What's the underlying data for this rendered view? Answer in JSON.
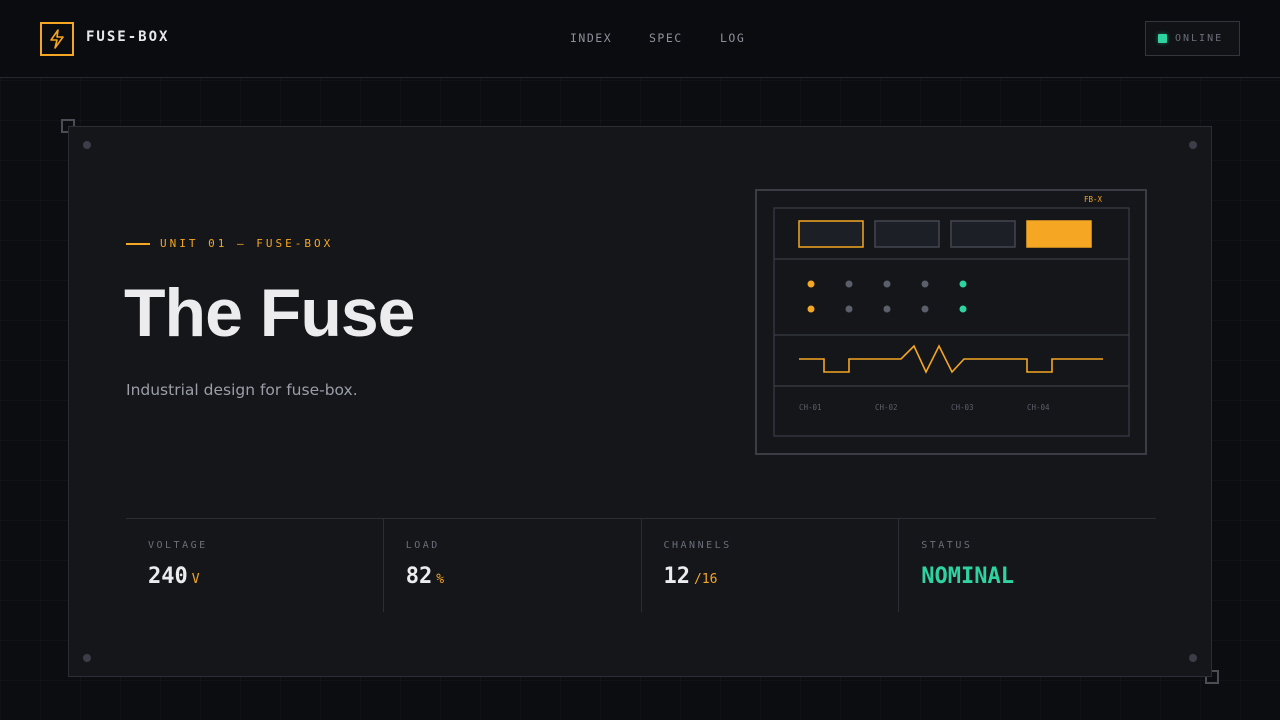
{
  "brand": {
    "name": "FUSE-BOX",
    "icon": "lightning-icon",
    "accent": "#f5a623"
  },
  "nav": {
    "items": [
      {
        "label": "INDEX"
      },
      {
        "label": "SPEC"
      },
      {
        "label": "LOG"
      }
    ]
  },
  "status": {
    "label": "ONLINE",
    "color": "#2ed3a0"
  },
  "hero": {
    "eyebrow": "UNIT 01 — FUSE-BOX",
    "title": "The Fuse",
    "subtitle": "Industrial design for fuse-box."
  },
  "diagram": {
    "tag": "FB-X",
    "channels": [
      "CH-01",
      "CH-02",
      "CH-03",
      "CH-04"
    ]
  },
  "stats": [
    {
      "label": "VOLTAGE",
      "value": "240",
      "unit": "V"
    },
    {
      "label": "LOAD",
      "value": "82",
      "unit": "%"
    },
    {
      "label": "CHANNELS",
      "value": "12",
      "unit": "/16"
    },
    {
      "label": "STATUS",
      "value": "NOMINAL",
      "unit": ""
    }
  ]
}
